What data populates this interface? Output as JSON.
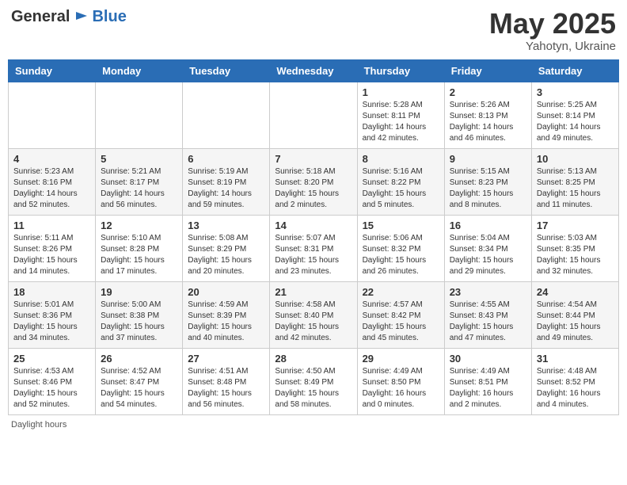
{
  "logo": {
    "general": "General",
    "blue": "Blue"
  },
  "header": {
    "month": "May 2025",
    "location": "Yahotyn, Ukraine"
  },
  "days_of_week": [
    "Sunday",
    "Monday",
    "Tuesday",
    "Wednesday",
    "Thursday",
    "Friday",
    "Saturday"
  ],
  "weeks": [
    [
      {
        "day": "",
        "info": ""
      },
      {
        "day": "",
        "info": ""
      },
      {
        "day": "",
        "info": ""
      },
      {
        "day": "",
        "info": ""
      },
      {
        "day": "1",
        "info": "Sunrise: 5:28 AM\nSunset: 8:11 PM\nDaylight: 14 hours\nand 42 minutes."
      },
      {
        "day": "2",
        "info": "Sunrise: 5:26 AM\nSunset: 8:13 PM\nDaylight: 14 hours\nand 46 minutes."
      },
      {
        "day": "3",
        "info": "Sunrise: 5:25 AM\nSunset: 8:14 PM\nDaylight: 14 hours\nand 49 minutes."
      }
    ],
    [
      {
        "day": "4",
        "info": "Sunrise: 5:23 AM\nSunset: 8:16 PM\nDaylight: 14 hours\nand 52 minutes."
      },
      {
        "day": "5",
        "info": "Sunrise: 5:21 AM\nSunset: 8:17 PM\nDaylight: 14 hours\nand 56 minutes."
      },
      {
        "day": "6",
        "info": "Sunrise: 5:19 AM\nSunset: 8:19 PM\nDaylight: 14 hours\nand 59 minutes."
      },
      {
        "day": "7",
        "info": "Sunrise: 5:18 AM\nSunset: 8:20 PM\nDaylight: 15 hours\nand 2 minutes."
      },
      {
        "day": "8",
        "info": "Sunrise: 5:16 AM\nSunset: 8:22 PM\nDaylight: 15 hours\nand 5 minutes."
      },
      {
        "day": "9",
        "info": "Sunrise: 5:15 AM\nSunset: 8:23 PM\nDaylight: 15 hours\nand 8 minutes."
      },
      {
        "day": "10",
        "info": "Sunrise: 5:13 AM\nSunset: 8:25 PM\nDaylight: 15 hours\nand 11 minutes."
      }
    ],
    [
      {
        "day": "11",
        "info": "Sunrise: 5:11 AM\nSunset: 8:26 PM\nDaylight: 15 hours\nand 14 minutes."
      },
      {
        "day": "12",
        "info": "Sunrise: 5:10 AM\nSunset: 8:28 PM\nDaylight: 15 hours\nand 17 minutes."
      },
      {
        "day": "13",
        "info": "Sunrise: 5:08 AM\nSunset: 8:29 PM\nDaylight: 15 hours\nand 20 minutes."
      },
      {
        "day": "14",
        "info": "Sunrise: 5:07 AM\nSunset: 8:31 PM\nDaylight: 15 hours\nand 23 minutes."
      },
      {
        "day": "15",
        "info": "Sunrise: 5:06 AM\nSunset: 8:32 PM\nDaylight: 15 hours\nand 26 minutes."
      },
      {
        "day": "16",
        "info": "Sunrise: 5:04 AM\nSunset: 8:34 PM\nDaylight: 15 hours\nand 29 minutes."
      },
      {
        "day": "17",
        "info": "Sunrise: 5:03 AM\nSunset: 8:35 PM\nDaylight: 15 hours\nand 32 minutes."
      }
    ],
    [
      {
        "day": "18",
        "info": "Sunrise: 5:01 AM\nSunset: 8:36 PM\nDaylight: 15 hours\nand 34 minutes."
      },
      {
        "day": "19",
        "info": "Sunrise: 5:00 AM\nSunset: 8:38 PM\nDaylight: 15 hours\nand 37 minutes."
      },
      {
        "day": "20",
        "info": "Sunrise: 4:59 AM\nSunset: 8:39 PM\nDaylight: 15 hours\nand 40 minutes."
      },
      {
        "day": "21",
        "info": "Sunrise: 4:58 AM\nSunset: 8:40 PM\nDaylight: 15 hours\nand 42 minutes."
      },
      {
        "day": "22",
        "info": "Sunrise: 4:57 AM\nSunset: 8:42 PM\nDaylight: 15 hours\nand 45 minutes."
      },
      {
        "day": "23",
        "info": "Sunrise: 4:55 AM\nSunset: 8:43 PM\nDaylight: 15 hours\nand 47 minutes."
      },
      {
        "day": "24",
        "info": "Sunrise: 4:54 AM\nSunset: 8:44 PM\nDaylight: 15 hours\nand 49 minutes."
      }
    ],
    [
      {
        "day": "25",
        "info": "Sunrise: 4:53 AM\nSunset: 8:46 PM\nDaylight: 15 hours\nand 52 minutes."
      },
      {
        "day": "26",
        "info": "Sunrise: 4:52 AM\nSunset: 8:47 PM\nDaylight: 15 hours\nand 54 minutes."
      },
      {
        "day": "27",
        "info": "Sunrise: 4:51 AM\nSunset: 8:48 PM\nDaylight: 15 hours\nand 56 minutes."
      },
      {
        "day": "28",
        "info": "Sunrise: 4:50 AM\nSunset: 8:49 PM\nDaylight: 15 hours\nand 58 minutes."
      },
      {
        "day": "29",
        "info": "Sunrise: 4:49 AM\nSunset: 8:50 PM\nDaylight: 16 hours\nand 0 minutes."
      },
      {
        "day": "30",
        "info": "Sunrise: 4:49 AM\nSunset: 8:51 PM\nDaylight: 16 hours\nand 2 minutes."
      },
      {
        "day": "31",
        "info": "Sunrise: 4:48 AM\nSunset: 8:52 PM\nDaylight: 16 hours\nand 4 minutes."
      }
    ]
  ],
  "footer": {
    "label": "Daylight hours"
  }
}
